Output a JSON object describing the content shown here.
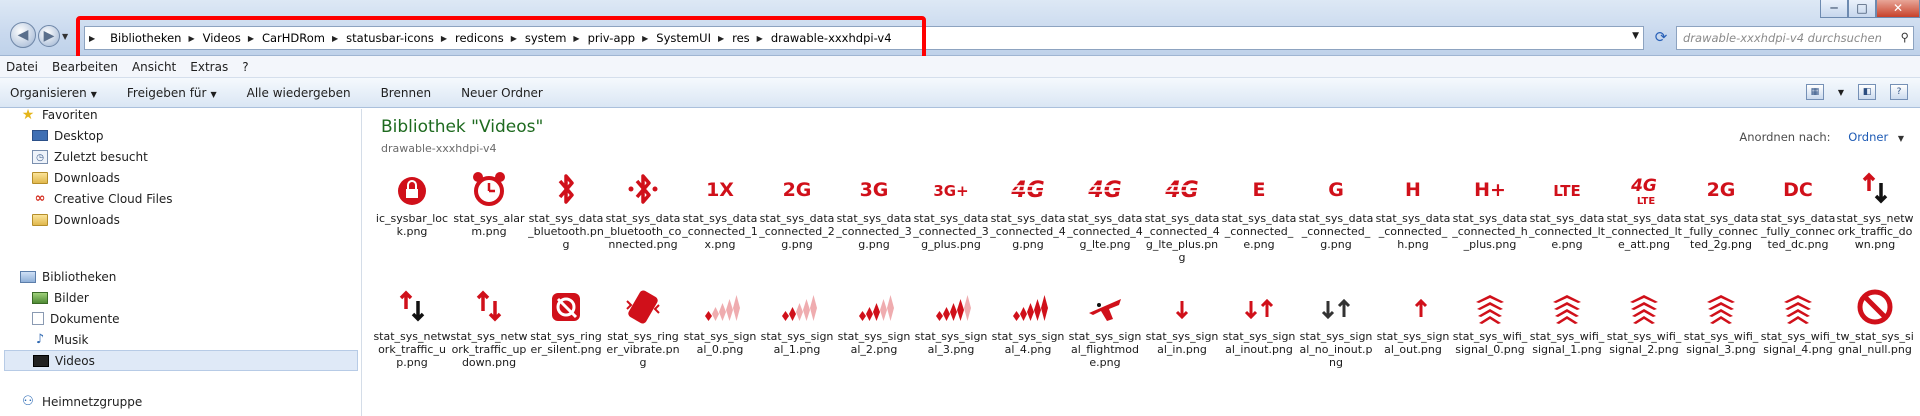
{
  "address": {
    "crumbs": [
      "Bibliotheken",
      "Videos",
      "CarHDRom",
      "statusbar-icons",
      "redicons",
      "system",
      "priv-app",
      "SystemUI",
      "res",
      "drawable-xxxhdpi-v4"
    ]
  },
  "search": {
    "placeholder": "drawable-xxxhdpi-v4 durchsuchen"
  },
  "window": {
    "minimize": "─",
    "maximize": "□",
    "close": "✕"
  },
  "menubar": [
    "Datei",
    "Bearbeiten",
    "Ansicht",
    "Extras",
    "?"
  ],
  "toolbar": {
    "organize": "Organisieren",
    "share": "Freigeben für",
    "play_all": "Alle wiedergeben",
    "burn": "Brennen",
    "new_folder": "Neuer Ordner"
  },
  "sidebar": {
    "favorites": "Favoriten",
    "fav_items": [
      "Desktop",
      "Zuletzt besucht",
      "Downloads",
      "Creative Cloud Files",
      "Downloads"
    ],
    "libraries": "Bibliotheken",
    "lib_items": [
      "Bilder",
      "Dokumente",
      "Musik",
      "Videos"
    ],
    "homegroup": "Heimnetzgruppe"
  },
  "main": {
    "title": "Bibliothek \"Videos\"",
    "subtitle": "drawable-xxxhdpi-v4",
    "arrange_label": "Anordnen nach:",
    "arrange_value": "Ordner"
  },
  "files": [
    {
      "name": "ic_sysbar_lock.png",
      "icon": "lock",
      "text": ""
    },
    {
      "name": "stat_sys_alarm.png",
      "icon": "alarm",
      "text": ""
    },
    {
      "name": "stat_sys_data_bluetooth.png",
      "icon": "bluetooth",
      "text": ""
    },
    {
      "name": "stat_sys_data_bluetooth_connected.png",
      "icon": "bluetooth-connected",
      "text": ""
    },
    {
      "name": "stat_sys_data_connected_1x.png",
      "icon": "text",
      "text": "1X"
    },
    {
      "name": "stat_sys_data_connected_2g.png",
      "icon": "text",
      "text": "2G"
    },
    {
      "name": "stat_sys_data_connected_3g.png",
      "icon": "text",
      "text": "3G"
    },
    {
      "name": "stat_sys_data_connected_3g_plus.png",
      "icon": "text",
      "text": "3G+"
    },
    {
      "name": "stat_sys_data_connected_4g.png",
      "icon": "text-striped",
      "text": "4G"
    },
    {
      "name": "stat_sys_data_connected_4g_lte.png",
      "icon": "text-striped",
      "text": "4G"
    },
    {
      "name": "stat_sys_data_connected_4g_lte_plus.png",
      "icon": "text-striped",
      "text": "4G"
    },
    {
      "name": "stat_sys_data_connected_e.png",
      "icon": "text",
      "text": "E"
    },
    {
      "name": "stat_sys_data_connected_g.png",
      "icon": "text",
      "text": "G"
    },
    {
      "name": "stat_sys_data_connected_h.png",
      "icon": "text",
      "text": "H"
    },
    {
      "name": "stat_sys_data_connected_h_plus.png",
      "icon": "text",
      "text": "H+"
    },
    {
      "name": "stat_sys_data_connected_lte.png",
      "icon": "text",
      "text": "LTE"
    },
    {
      "name": "stat_sys_data_connected_lte_att.png",
      "icon": "text-att",
      "text": "4G"
    },
    {
      "name": "stat_sys_data_fully_connected_2g.png",
      "icon": "text",
      "text": "2G"
    },
    {
      "name": "stat_sys_data_fully_connected_dc.png",
      "icon": "text",
      "text": "DC"
    },
    {
      "name": "stat_sys_network_traffic_down.png",
      "icon": "traffic-down",
      "text": ""
    },
    {
      "name": "stat_sys_network_traffic_up.png",
      "icon": "traffic-up",
      "text": ""
    },
    {
      "name": "stat_sys_network_traffic_updown.png",
      "icon": "traffic-updown",
      "text": ""
    },
    {
      "name": "stat_sys_ringer_silent.png",
      "icon": "ringer-silent",
      "text": ""
    },
    {
      "name": "stat_sys_ringer_vibrate.png",
      "icon": "ringer-vibrate",
      "text": ""
    },
    {
      "name": "stat_sys_signal_0.png",
      "icon": "signal",
      "level": 0.2,
      "text": ""
    },
    {
      "name": "stat_sys_signal_1.png",
      "icon": "signal",
      "level": 0.4,
      "text": ""
    },
    {
      "name": "stat_sys_signal_2.png",
      "icon": "signal",
      "level": 0.6,
      "text": ""
    },
    {
      "name": "stat_sys_signal_3.png",
      "icon": "signal",
      "level": 0.8,
      "text": ""
    },
    {
      "name": "stat_sys_signal_4.png",
      "icon": "signal",
      "level": 1.0,
      "text": ""
    },
    {
      "name": "stat_sys_signal_flightmode.png",
      "icon": "flightmode",
      "text": ""
    },
    {
      "name": "stat_sys_signal_in.png",
      "icon": "signal-in",
      "text": ""
    },
    {
      "name": "stat_sys_signal_inout.png",
      "icon": "signal-inout",
      "text": ""
    },
    {
      "name": "stat_sys_signal_no_inout.png",
      "icon": "signal-no-inout",
      "text": ""
    },
    {
      "name": "stat_sys_signal_out.png",
      "icon": "signal-out",
      "text": ""
    },
    {
      "name": "stat_sys_wifi_signal_0.png",
      "icon": "wifi",
      "text": ""
    },
    {
      "name": "stat_sys_wifi_signal_1.png",
      "icon": "wifi",
      "text": ""
    },
    {
      "name": "stat_sys_wifi_signal_2.png",
      "icon": "wifi",
      "text": ""
    },
    {
      "name": "stat_sys_wifi_signal_3.png",
      "icon": "wifi",
      "text": ""
    },
    {
      "name": "stat_sys_wifi_signal_4.png",
      "icon": "wifi",
      "text": ""
    },
    {
      "name": "tw_stat_sys_signal_null.png",
      "icon": "null",
      "text": ""
    }
  ],
  "colors": {
    "icon_red": "#d0101a",
    "title_green": "#1e6a1f",
    "highlight_red": "#ff0000"
  }
}
